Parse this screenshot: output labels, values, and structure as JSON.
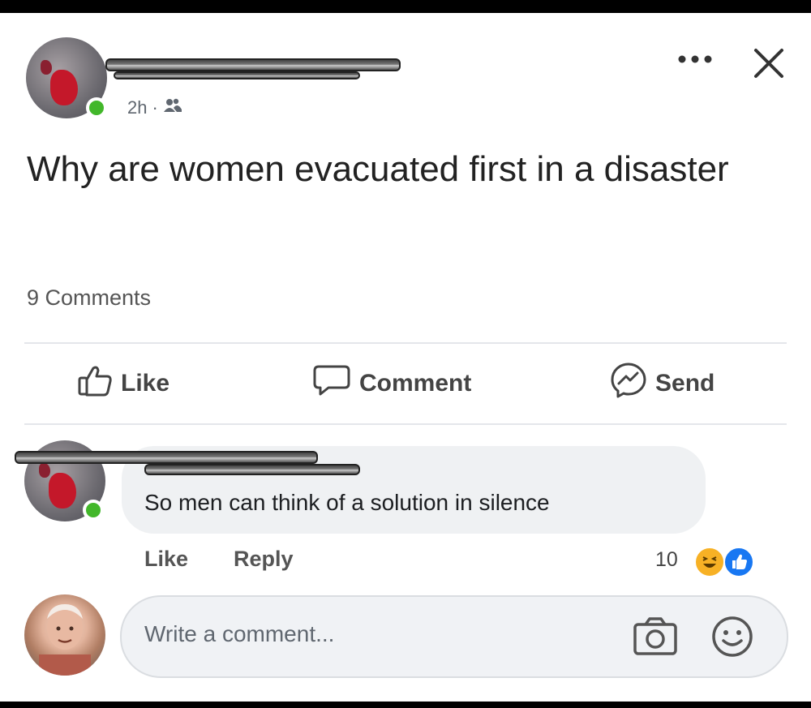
{
  "post": {
    "time": "2h",
    "separator": "·",
    "audience_icon": "friends-icon",
    "text": "Why are women evacuated first in a disaster",
    "comment_count": "9 Comments"
  },
  "header_icons": {
    "more": "more-icon",
    "close": "close-icon"
  },
  "actions": {
    "like": "Like",
    "comment": "Comment",
    "send": "Send"
  },
  "comment": {
    "text": "So men can think of a solution in silence",
    "like": "Like",
    "reply": "Reply",
    "reaction_count": "10",
    "reactions": [
      "haha-icon",
      "like-icon"
    ]
  },
  "composer": {
    "placeholder": "Write a comment...",
    "icons": [
      "camera-icon",
      "emoji-icon"
    ]
  },
  "colors": {
    "online": "#42b72a",
    "like_blue": "#1877f2",
    "haha_yellow": "#f7b125",
    "bubble": "#eff1f3"
  }
}
